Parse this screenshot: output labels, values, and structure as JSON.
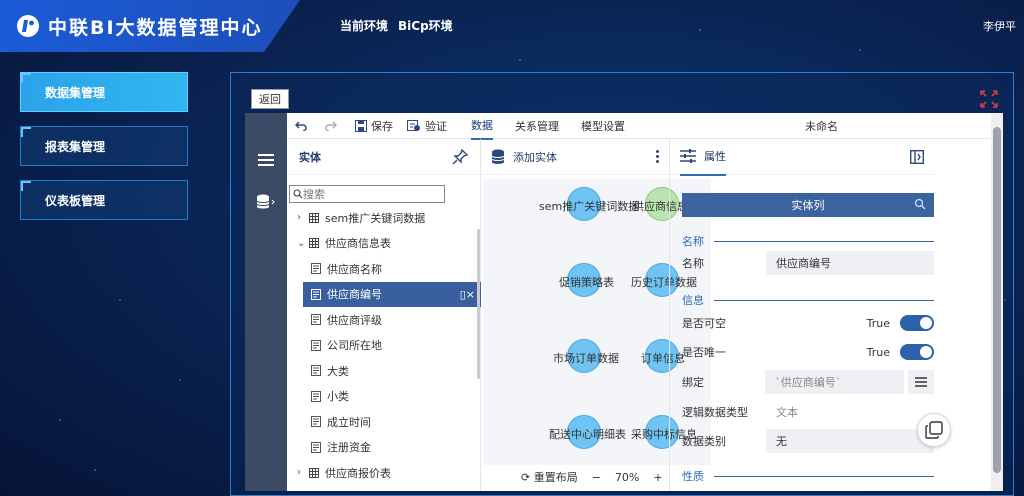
{
  "header": {
    "brand_title": "中联BI大数据管理中心",
    "env_label": "当前环境",
    "env_value": "BiCp环境",
    "user_name": "李伊平"
  },
  "side_nav": {
    "items": [
      {
        "label": "数据集管理",
        "active": true
      },
      {
        "label": "报表集管理",
        "active": false
      },
      {
        "label": "仪表板管理",
        "active": false
      }
    ]
  },
  "frame": {
    "back_label": "返回"
  },
  "toolbar": {
    "save_label": "保存",
    "validate_label": "验证",
    "tabs": [
      "数据",
      "关系管理",
      "模型设置"
    ],
    "active_tab": "数据",
    "doc_title": "未命名"
  },
  "entity_panel": {
    "title": "实体",
    "search_placeholder": "搜索",
    "tree": [
      {
        "level": 0,
        "label": "sem推广关键词数据",
        "expanded": false
      },
      {
        "level": 0,
        "label": "供应商信息表",
        "expanded": true
      },
      {
        "level": 1,
        "label": "供应商名称"
      },
      {
        "level": 1,
        "label": "供应商编号",
        "selected": true
      },
      {
        "level": 1,
        "label": "供应商评级"
      },
      {
        "level": 1,
        "label": "公司所在地"
      },
      {
        "level": 1,
        "label": "大类"
      },
      {
        "level": 1,
        "label": "小类"
      },
      {
        "level": 1,
        "label": "成立时间"
      },
      {
        "level": 1,
        "label": "注册资金"
      },
      {
        "level": 0,
        "label": "供应商报价表",
        "expanded": false
      }
    ]
  },
  "canvas": {
    "add_entity_label": "添加实体",
    "nodes": [
      {
        "label": "sem推广关键词数据"
      },
      {
        "label": "供应商信息表"
      },
      {
        "label": "促销策略表"
      },
      {
        "label": "历史订单数据"
      },
      {
        "label": "市场订单数据"
      },
      {
        "label": "订单信息"
      },
      {
        "label": "配送中心明细表"
      },
      {
        "label": "采购中标信息"
      }
    ],
    "reset_layout_label": "重置布局",
    "zoom": "70%"
  },
  "properties": {
    "tab_label": "属性",
    "entity_column_label": "实体列",
    "section_name": "名称",
    "name_label": "名称",
    "name_value": "供应商编号",
    "section_info": "信息",
    "nullable_label": "是否可空",
    "nullable_value": "True",
    "unique_label": "是否唯一",
    "unique_value": "True",
    "bind_label": "绑定",
    "bind_value": "`供应商编号`",
    "logic_type_label": "逻辑数据类型",
    "logic_type_value": "文本",
    "data_category_label": "数据类别",
    "data_category_value": "无",
    "section_nature": "性质"
  },
  "colors": {
    "brand_blue": "#1b5bd8",
    "nav_active": "#2ba3ea",
    "rail": "#3b4b66",
    "accent": "#2d6bb5",
    "node_blue": "#6fc4f3",
    "node_green": "#b9e3b0"
  }
}
